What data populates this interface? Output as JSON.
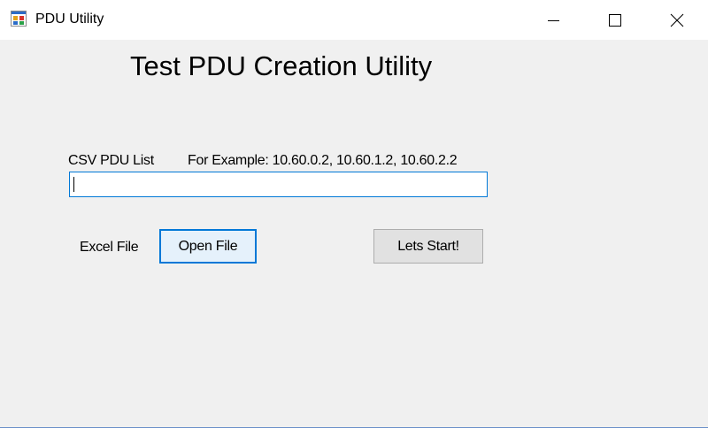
{
  "window": {
    "title": "PDU Utility",
    "app_icon": "windows-form-icon",
    "controls": {
      "minimize_icon": "minimize-icon",
      "maximize_icon": "maximize-icon",
      "close_icon": "close-icon"
    }
  },
  "form": {
    "heading": "Test PDU Creation Utility",
    "csv_label": "CSV PDU List",
    "example_label": "For Example: 10.60.0.2, 10.60.1.2, 10.60.2.2",
    "csv_input_value": "",
    "excel_label": "Excel File",
    "open_file_button": "Open File",
    "start_button": "Lets Start!"
  },
  "colors": {
    "window_background": "#f0f0f0",
    "titlebar_background": "#ffffff",
    "focus_accent": "#0078d7",
    "default_button": "#e1e1e1",
    "focused_button": "#e5f1fb"
  }
}
